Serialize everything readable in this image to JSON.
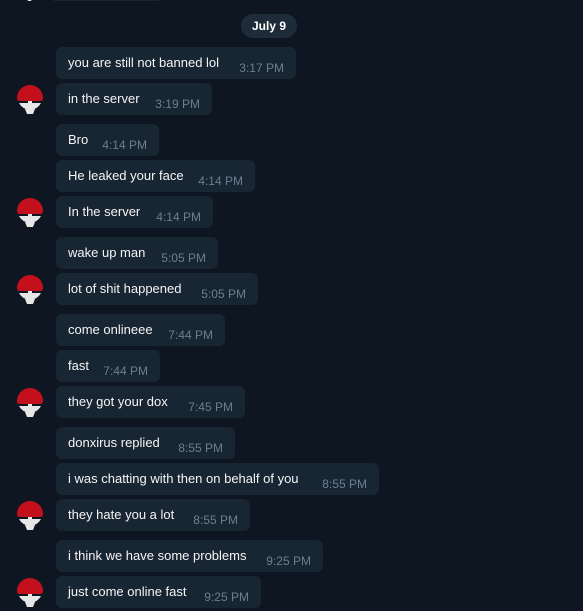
{
  "date_separator": "July 9",
  "messages": [
    {
      "text": "you are still not banned lol",
      "time": "3:17 PM"
    },
    {
      "text": "in the server",
      "time": "3:19 PM"
    },
    {
      "text": "Bro",
      "time": "4:14 PM"
    },
    {
      "text": "He leaked your face",
      "time": "4:14 PM"
    },
    {
      "text": "In the server",
      "time": "4:14 PM"
    },
    {
      "text": "wake up man",
      "time": "5:05 PM"
    },
    {
      "text": "lot of shit happened",
      "time": "5:05 PM"
    },
    {
      "text": "come onlineee",
      "time": "7:44 PM"
    },
    {
      "text": "fast",
      "time": "7:44 PM"
    },
    {
      "text": "they got your dox",
      "time": "7:45 PM"
    },
    {
      "text": "donxirus replied",
      "time": "8:55 PM"
    },
    {
      "text": "i was chatting with then on behalf of you",
      "time": "8:55 PM"
    },
    {
      "text": "they hate you a lot",
      "time": "8:55 PM"
    },
    {
      "text": "i think we have some problems",
      "time": "9:25 PM"
    },
    {
      "text": "just come online fast",
      "time": "9:25 PM"
    }
  ],
  "avatar_icon": "uchiha-clan-symbol-icon",
  "colors": {
    "background": "#0e1621",
    "bubble": "#182533",
    "date_pill": "#1e2c3a",
    "message_text": "#f5f5f5",
    "time_text": "#6d7f8f",
    "avatar_red": "#c4101c",
    "avatar_white": "#e6e6e6"
  }
}
